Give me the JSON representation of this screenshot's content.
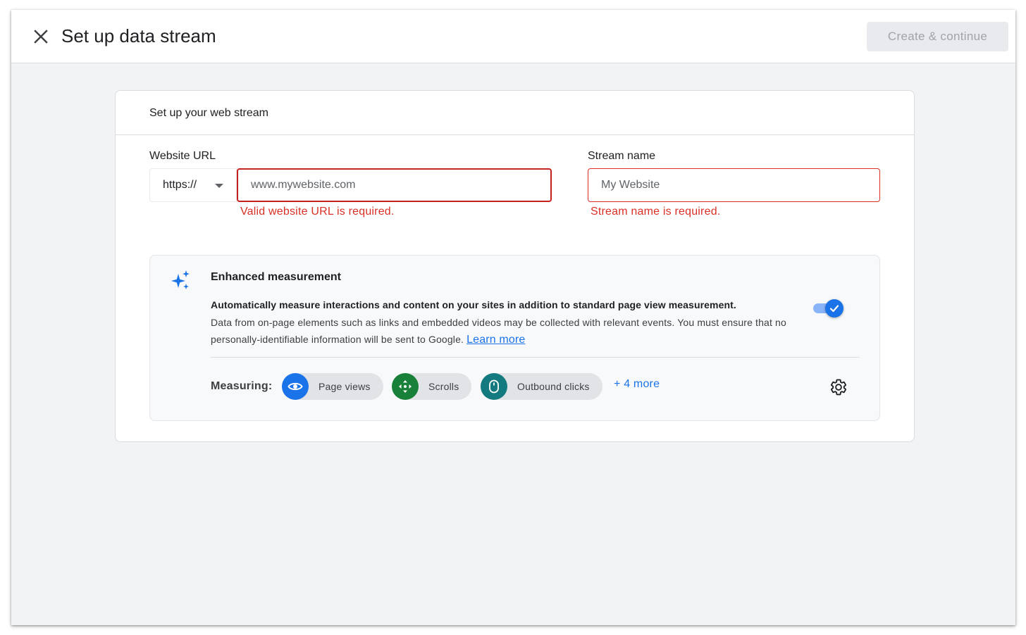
{
  "header": {
    "title": "Set up data stream",
    "primary_button": "Create & continue"
  },
  "card": {
    "title": "Set up your web stream",
    "website_url": {
      "label": "Website URL",
      "protocol": "https://",
      "placeholder": "www.mywebsite.com",
      "value": "",
      "error": "Valid website URL is required."
    },
    "stream_name": {
      "label": "Stream name",
      "placeholder": "My Website",
      "value": "",
      "error": "Stream name is required."
    },
    "enhanced_measurement": {
      "title": "Enhanced measurement",
      "lead": "Automatically measure interactions and content on your sites in addition to standard page view measurement.",
      "body": "Data from on-page elements such as links and embedded videos may be collected with relevant events. You must ensure that no personally-identifiable information will be sent to Google.",
      "learn_more": "Learn more",
      "enabled": true,
      "measuring_label": "Measuring:",
      "chips": [
        {
          "label": "Page views",
          "icon": "eye-icon",
          "color": "#1a73e8"
        },
        {
          "label": "Scrolls",
          "icon": "scroll-arrows-icon",
          "color": "#188038"
        },
        {
          "label": "Outbound clicks",
          "icon": "mouse-icon",
          "color": "#137a7f"
        }
      ],
      "more_link": "+ 4 more"
    }
  },
  "colors": {
    "accent": "#1a73e8",
    "error": "#d93025",
    "page_background": "#f1f3f4"
  }
}
